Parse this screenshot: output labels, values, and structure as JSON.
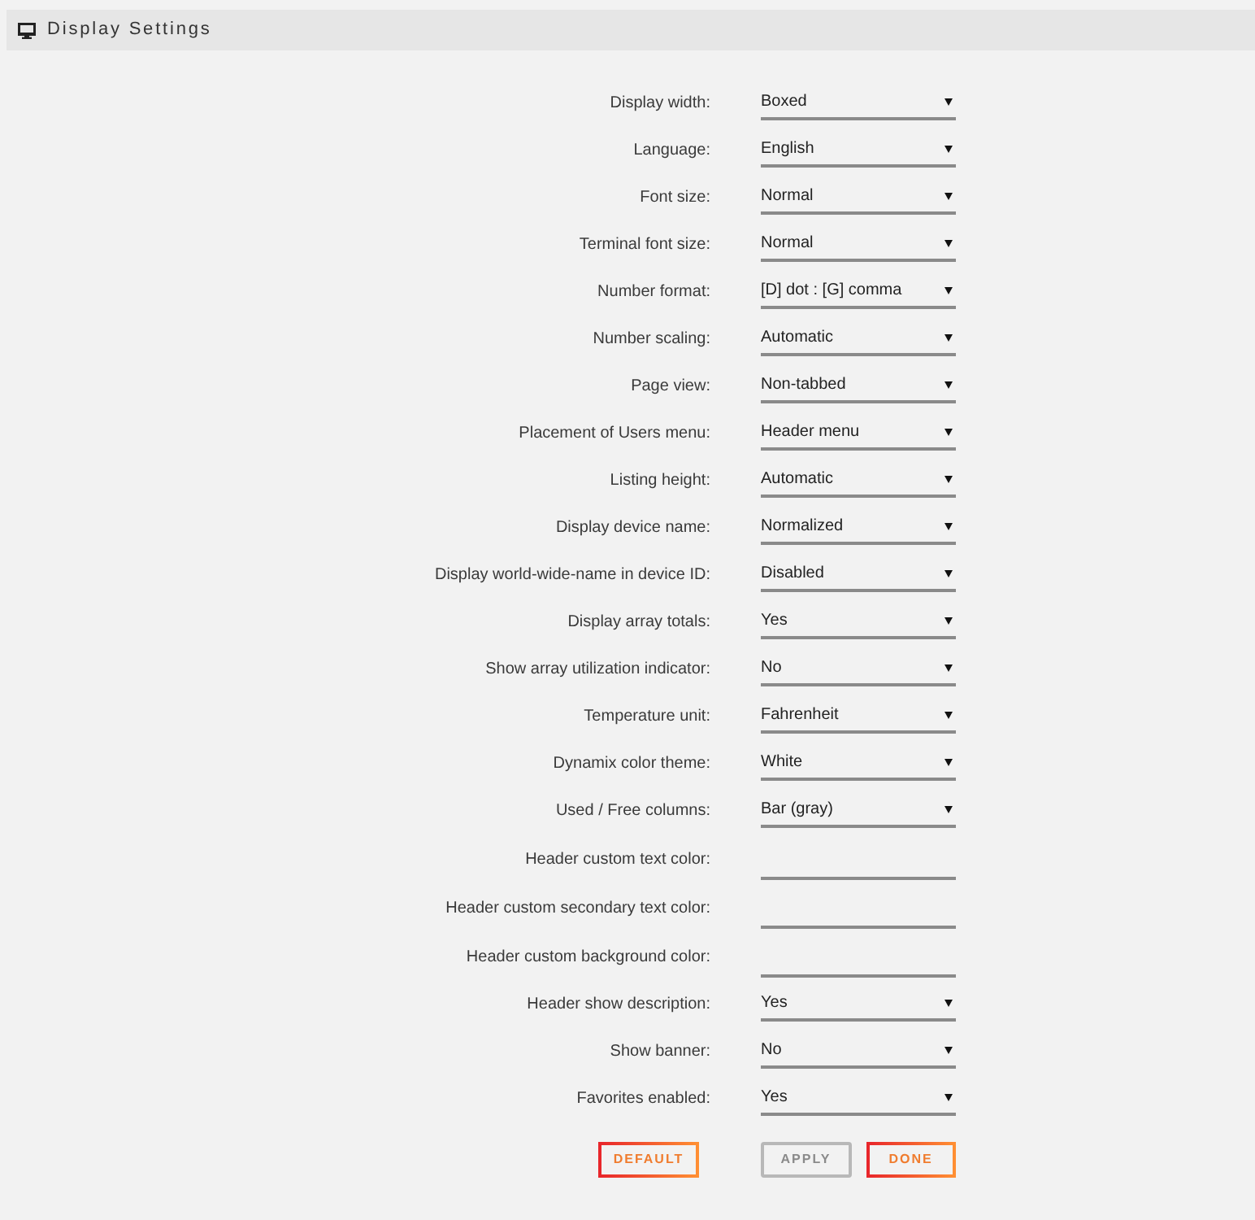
{
  "header": {
    "title": "Display Settings"
  },
  "settings": [
    {
      "label": "Display width:",
      "kind": "select",
      "value": "Boxed"
    },
    {
      "label": "Language:",
      "kind": "select",
      "value": "English"
    },
    {
      "label": "Font size:",
      "kind": "select",
      "value": "Normal"
    },
    {
      "label": "Terminal font size:",
      "kind": "select",
      "value": "Normal"
    },
    {
      "label": "Number format:",
      "kind": "select",
      "value": "[D] dot : [G] comma"
    },
    {
      "label": "Number scaling:",
      "kind": "select",
      "value": "Automatic"
    },
    {
      "label": "Page view:",
      "kind": "select",
      "value": "Non-tabbed"
    },
    {
      "label": "Placement of Users menu:",
      "kind": "select",
      "value": "Header menu"
    },
    {
      "label": "Listing height:",
      "kind": "select",
      "value": "Automatic"
    },
    {
      "label": "Display device name:",
      "kind": "select",
      "value": "Normalized"
    },
    {
      "label": "Display world-wide-name in device ID:",
      "kind": "select",
      "value": "Disabled"
    },
    {
      "label": "Display array totals:",
      "kind": "select",
      "value": "Yes"
    },
    {
      "label": "Show array utilization indicator:",
      "kind": "select",
      "value": "No"
    },
    {
      "label": "Temperature unit:",
      "kind": "select",
      "value": "Fahrenheit"
    },
    {
      "label": "Dynamix color theme:",
      "kind": "select",
      "value": "White"
    },
    {
      "label": "Used / Free columns:",
      "kind": "select",
      "value": "Bar (gray)"
    },
    {
      "label": "Header custom text color:",
      "kind": "text"
    },
    {
      "label": "Header custom secondary text color:",
      "kind": "text"
    },
    {
      "label": "Header custom background color:",
      "kind": "text"
    },
    {
      "label": "Header show description:",
      "kind": "select",
      "value": "Yes"
    },
    {
      "label": "Show banner:",
      "kind": "select",
      "value": "No"
    },
    {
      "label": "Favorites enabled:",
      "kind": "select",
      "value": "Yes"
    }
  ],
  "buttons": [
    {
      "label": "DEFAULT",
      "disabled": false
    },
    {
      "label": "APPLY",
      "disabled": true
    },
    {
      "label": "DONE",
      "disabled": false
    }
  ]
}
